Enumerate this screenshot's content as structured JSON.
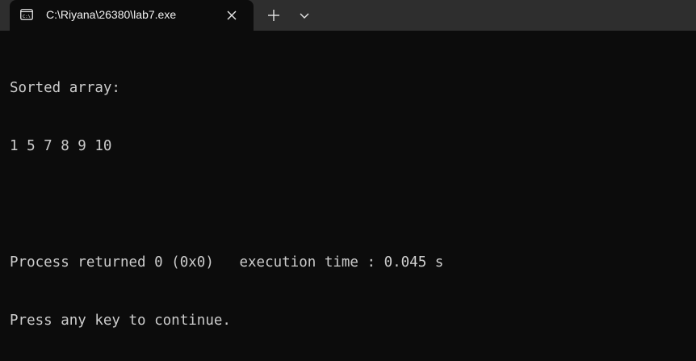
{
  "window": {
    "tab_title": "C:\\Riyana\\26380\\lab7.exe",
    "tab_icon": "terminal-icon",
    "close_icon": "close-icon",
    "new_tab_icon": "plus-icon",
    "dropdown_icon": "chevron-down-icon"
  },
  "console": {
    "lines": [
      "Sorted array:",
      "1 5 7 8 9 10",
      "",
      "Process returned 0 (0x0)   execution time : 0.045 s",
      "Press any key to continue."
    ]
  },
  "colors": {
    "background": "#0c0c0c",
    "titlebar": "#2e2e2e",
    "text": "#cccccc"
  }
}
